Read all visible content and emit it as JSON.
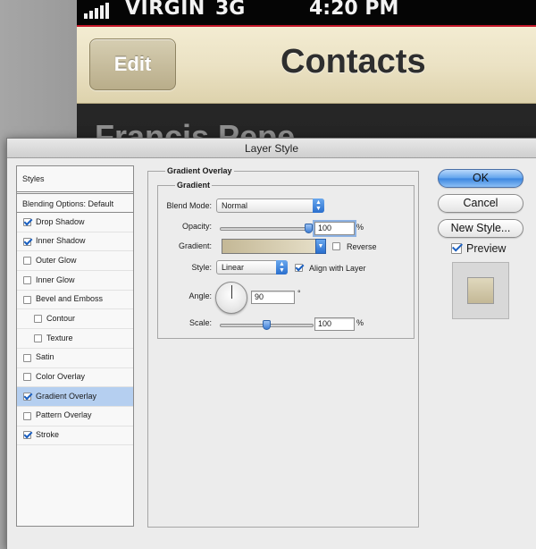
{
  "phone": {
    "carrier": "VIRGIN",
    "network": "3G",
    "time": "4:20 PM",
    "edit_label": "Edit",
    "title": "Contacts",
    "contact_name": "Francis Pepe",
    "accent_color": "#c4182a"
  },
  "dialog": {
    "title": "Layer Style",
    "styles_header": "Styles",
    "blending_options": "Blending Options: Default",
    "styles": [
      {
        "label": "Drop Shadow",
        "checked": true
      },
      {
        "label": "Inner Shadow",
        "checked": true
      },
      {
        "label": "Outer Glow",
        "checked": false
      },
      {
        "label": "Inner Glow",
        "checked": false
      },
      {
        "label": "Bevel and Emboss",
        "checked": false
      },
      {
        "label": "Contour",
        "checked": false
      },
      {
        "label": "Texture",
        "checked": false
      },
      {
        "label": "Satin",
        "checked": false
      },
      {
        "label": "Color Overlay",
        "checked": false
      },
      {
        "label": "Gradient Overlay",
        "checked": true,
        "selected": true
      },
      {
        "label": "Pattern Overlay",
        "checked": false
      },
      {
        "label": "Stroke",
        "checked": true
      }
    ],
    "section_title": "Gradient Overlay",
    "group_title": "Gradient",
    "blend_mode_label": "Blend Mode:",
    "blend_mode_value": "Normal",
    "opacity_label": "Opacity:",
    "opacity_value": "100",
    "opacity_percent": 1.0,
    "percent_sign": "%",
    "gradient_label": "Gradient:",
    "gradient_colors": [
      "#c4b896",
      "#e6dfc8"
    ],
    "reverse_label": "Reverse",
    "reverse_checked": false,
    "style_label": "Style:",
    "style_value": "Linear",
    "align_label": "Align with Layer",
    "align_checked": true,
    "angle_label": "Angle:",
    "angle_value": "90",
    "degree_sign": "°",
    "scale_label": "Scale:",
    "scale_value": "100",
    "scale_fraction": 0.5,
    "ok_label": "OK",
    "cancel_label": "Cancel",
    "new_style_label": "New Style...",
    "preview_label": "Preview",
    "preview_checked": true
  }
}
